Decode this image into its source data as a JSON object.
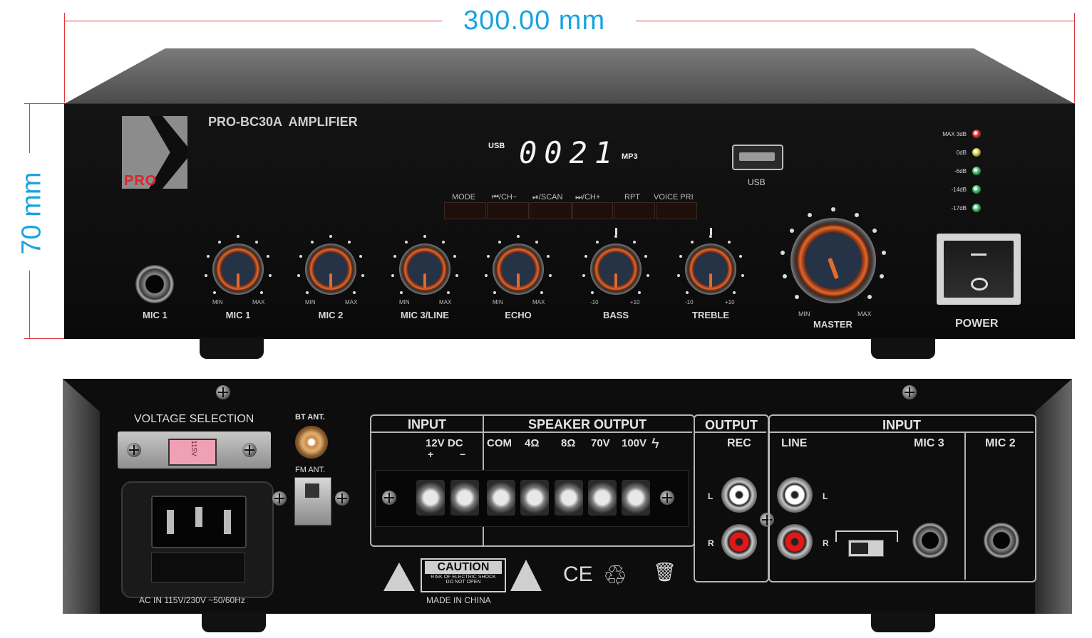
{
  "dimensions": {
    "width_label": "300.00 mm",
    "height_label": "70 mm"
  },
  "front": {
    "model_label": "PRO-BC30A  AMPLIFIER",
    "logo_text": "PRO",
    "display": {
      "source_label": "USB",
      "digits": "0021",
      "format_label": "MP3"
    },
    "usb_port_label": "USB",
    "buttons": [
      "MODE",
      "⏮/CH−",
      "⏯/SCAN",
      "⏭/CH+",
      "RPT",
      "VOICE PRI"
    ],
    "mic_jack_label": "MIC 1",
    "knobs": [
      {
        "label": "MIC 1",
        "min": "MIN",
        "max": "MAX"
      },
      {
        "label": "MIC 2",
        "min": "MIN",
        "max": "MAX"
      },
      {
        "label": "MIC 3/LINE",
        "min": "MIN",
        "max": "MAX"
      },
      {
        "label": "ECHO",
        "min": "MIN",
        "max": "MAX"
      },
      {
        "label": "BASS",
        "min": "-10",
        "max": "+10"
      },
      {
        "label": "TREBLE",
        "min": "-10",
        "max": "+10"
      }
    ],
    "master": {
      "label": "MASTER",
      "min": "MIN",
      "max": "MAX"
    },
    "power_label": "POWER",
    "meter": [
      {
        "label": "MAX 3dB",
        "color": "#e0302a"
      },
      {
        "label": "0dB",
        "color": "#d8d04a"
      },
      {
        "label": "-6dB",
        "color": "#3fbf6a"
      },
      {
        "label": "-14dB",
        "color": "#3fbf6a"
      },
      {
        "label": "-17dB",
        "color": "#3fbf6a"
      }
    ]
  },
  "back": {
    "voltage_selection": "VOLTAGE SELECTION",
    "voltage_value": "115V",
    "ac_in": "AC IN 115V/230V ~50/60Hz",
    "bt_ant": "BT ANT.",
    "fm_ant": "FM ANT.",
    "input_left": {
      "title": "INPUT",
      "dc": "12V DC",
      "plus": "+",
      "minus": "−"
    },
    "speaker_output": {
      "title": "SPEAKER OUTPUT",
      "terms": [
        "COM",
        "4Ω",
        "8Ω",
        "70V",
        "100V"
      ]
    },
    "output": {
      "title": "OUTPUT",
      "rec": "REC",
      "l": "L",
      "r": "R"
    },
    "input_right": {
      "title": "INPUT",
      "line": "LINE",
      "mic3": "MIC 3",
      "mic2": "MIC 2",
      "l": "L",
      "r": "R"
    },
    "caution": {
      "title": "CAUTION",
      "line1": "RISK OF ELECTRIC SHOCK",
      "line2": "DO NOT OPEN"
    },
    "ce": "CE",
    "made_in": "MADE IN CHINA"
  }
}
